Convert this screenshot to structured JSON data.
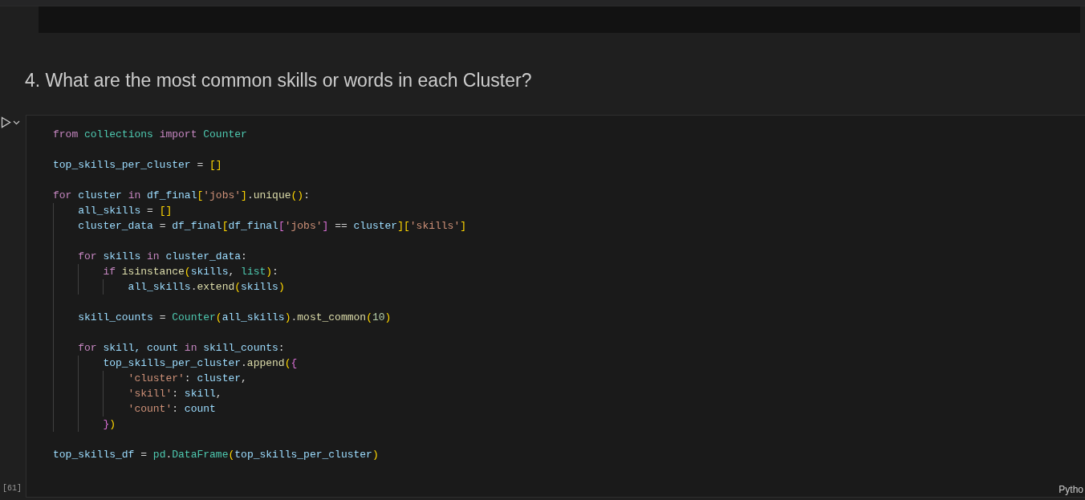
{
  "heading": "4. What are the most common skills or words in each Cluster?",
  "cell": {
    "execution_count": "[61]",
    "language": "Pytho",
    "lines": [
      {
        "kind": "code",
        "tokens": [
          {
            "text": "from",
            "kind": "keyword"
          },
          {
            "text": " collections",
            "kind": "module"
          },
          {
            "text": " import",
            "kind": "keyword"
          },
          {
            "text": " Counter",
            "kind": "module"
          }
        ]
      },
      {
        "kind": "blank"
      },
      {
        "kind": "code",
        "tokens": [
          {
            "text": "top_skills_per_cluster",
            "kind": "variable"
          },
          {
            "text": " = ",
            "kind": "plain"
          },
          {
            "text": "[]",
            "kind": "bracket1"
          }
        ]
      },
      {
        "kind": "blank"
      },
      {
        "kind": "code",
        "tokens": [
          {
            "text": "for",
            "kind": "keyword"
          },
          {
            "text": " cluster ",
            "kind": "variable"
          },
          {
            "text": "in",
            "kind": "keyword"
          },
          {
            "text": " df_final",
            "kind": "variable"
          },
          {
            "text": "[",
            "kind": "bracket1"
          },
          {
            "text": "'jobs'",
            "kind": "string"
          },
          {
            "text": "]",
            "kind": "bracket1"
          },
          {
            "text": ".",
            "kind": "plain"
          },
          {
            "text": "unique",
            "kind": "function"
          },
          {
            "text": "()",
            "kind": "bracket1"
          },
          {
            "text": ":",
            "kind": "plain"
          }
        ]
      },
      {
        "kind": "code",
        "tokens": [
          {
            "text": "    all_skills",
            "kind": "variable"
          },
          {
            "text": " = ",
            "kind": "plain"
          },
          {
            "text": "[]",
            "kind": "bracket1"
          }
        ]
      },
      {
        "kind": "code",
        "tokens": [
          {
            "text": "    cluster_data",
            "kind": "variable"
          },
          {
            "text": " = ",
            "kind": "plain"
          },
          {
            "text": "df_final",
            "kind": "variable"
          },
          {
            "text": "[",
            "kind": "bracket1"
          },
          {
            "text": "df_final",
            "kind": "variable"
          },
          {
            "text": "[",
            "kind": "bracket2"
          },
          {
            "text": "'jobs'",
            "kind": "string"
          },
          {
            "text": "]",
            "kind": "bracket2"
          },
          {
            "text": " == ",
            "kind": "plain"
          },
          {
            "text": "cluster",
            "kind": "variable"
          },
          {
            "text": "]",
            "kind": "bracket1"
          },
          {
            "text": "[",
            "kind": "bracket1"
          },
          {
            "text": "'skills'",
            "kind": "string"
          },
          {
            "text": "]",
            "kind": "bracket1"
          }
        ]
      },
      {
        "kind": "blank"
      },
      {
        "kind": "code",
        "tokens": [
          {
            "text": "    for",
            "kind": "keyword"
          },
          {
            "text": " skills ",
            "kind": "variable"
          },
          {
            "text": "in",
            "kind": "keyword"
          },
          {
            "text": " cluster_data",
            "kind": "variable"
          },
          {
            "text": ":",
            "kind": "plain"
          }
        ]
      },
      {
        "kind": "code",
        "tokens": [
          {
            "text": "        if",
            "kind": "keyword"
          },
          {
            "text": " isinstance",
            "kind": "function"
          },
          {
            "text": "(",
            "kind": "bracket1"
          },
          {
            "text": "skills",
            "kind": "variable"
          },
          {
            "text": ", ",
            "kind": "plain"
          },
          {
            "text": "list",
            "kind": "module"
          },
          {
            "text": ")",
            "kind": "bracket1"
          },
          {
            "text": ":",
            "kind": "plain"
          }
        ]
      },
      {
        "kind": "code",
        "tokens": [
          {
            "text": "            all_skills",
            "kind": "variable"
          },
          {
            "text": ".",
            "kind": "plain"
          },
          {
            "text": "extend",
            "kind": "function"
          },
          {
            "text": "(",
            "kind": "bracket1"
          },
          {
            "text": "skills",
            "kind": "variable"
          },
          {
            "text": ")",
            "kind": "bracket1"
          }
        ]
      },
      {
        "kind": "blank"
      },
      {
        "kind": "code",
        "tokens": [
          {
            "text": "    skill_counts",
            "kind": "variable"
          },
          {
            "text": " = ",
            "kind": "plain"
          },
          {
            "text": "Counter",
            "kind": "module"
          },
          {
            "text": "(",
            "kind": "bracket1"
          },
          {
            "text": "all_skills",
            "kind": "variable"
          },
          {
            "text": ")",
            "kind": "bracket1"
          },
          {
            "text": ".",
            "kind": "plain"
          },
          {
            "text": "most_common",
            "kind": "function"
          },
          {
            "text": "(",
            "kind": "bracket1"
          },
          {
            "text": "10",
            "kind": "number"
          },
          {
            "text": ")",
            "kind": "bracket1"
          }
        ]
      },
      {
        "kind": "blank"
      },
      {
        "kind": "code",
        "tokens": [
          {
            "text": "    for",
            "kind": "keyword"
          },
          {
            "text": " skill, count ",
            "kind": "variable"
          },
          {
            "text": "in",
            "kind": "keyword"
          },
          {
            "text": " skill_counts",
            "kind": "variable"
          },
          {
            "text": ":",
            "kind": "plain"
          }
        ]
      },
      {
        "kind": "code",
        "tokens": [
          {
            "text": "        top_skills_per_cluster",
            "kind": "variable"
          },
          {
            "text": ".",
            "kind": "plain"
          },
          {
            "text": "append",
            "kind": "function"
          },
          {
            "text": "(",
            "kind": "bracket1"
          },
          {
            "text": "{",
            "kind": "bracket2"
          }
        ]
      },
      {
        "kind": "code",
        "tokens": [
          {
            "text": "            'cluster'",
            "kind": "string"
          },
          {
            "text": ": ",
            "kind": "plain"
          },
          {
            "text": "cluster",
            "kind": "variable"
          },
          {
            "text": ",",
            "kind": "plain"
          }
        ]
      },
      {
        "kind": "code",
        "tokens": [
          {
            "text": "            'skill'",
            "kind": "string"
          },
          {
            "text": ": ",
            "kind": "plain"
          },
          {
            "text": "skill",
            "kind": "variable"
          },
          {
            "text": ",",
            "kind": "plain"
          }
        ]
      },
      {
        "kind": "code",
        "tokens": [
          {
            "text": "            'count'",
            "kind": "string"
          },
          {
            "text": ": ",
            "kind": "plain"
          },
          {
            "text": "count",
            "kind": "variable"
          }
        ]
      },
      {
        "kind": "code",
        "tokens": [
          {
            "text": "        }",
            "kind": "bracket2"
          },
          {
            "text": ")",
            "kind": "bracket1"
          }
        ]
      },
      {
        "kind": "blank"
      },
      {
        "kind": "code",
        "tokens": [
          {
            "text": "top_skills_df",
            "kind": "variable"
          },
          {
            "text": " = ",
            "kind": "plain"
          },
          {
            "text": "pd",
            "kind": "module"
          },
          {
            "text": ".",
            "kind": "plain"
          },
          {
            "text": "DataFrame",
            "kind": "module"
          },
          {
            "text": "(",
            "kind": "bracket1"
          },
          {
            "text": "top_skills_per_cluster",
            "kind": "variable"
          },
          {
            "text": ")",
            "kind": "bracket1"
          }
        ]
      }
    ]
  }
}
